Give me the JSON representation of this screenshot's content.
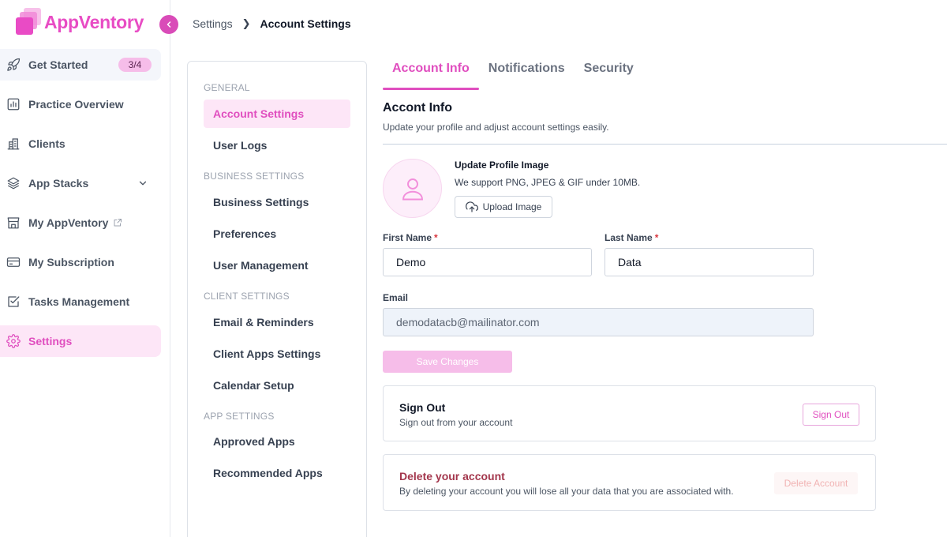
{
  "app": {
    "name": "AppVentory",
    "colors": {
      "accent": "#e04ebf",
      "accent_light": "#fde6f7",
      "danger": "#a3364c"
    }
  },
  "sidebar": {
    "items": [
      {
        "label": "Get Started",
        "icon": "rocket-icon",
        "badge": "3/4"
      },
      {
        "label": "Practice Overview",
        "icon": "chart-icon"
      },
      {
        "label": "Clients",
        "icon": "building-icon"
      },
      {
        "label": "App Stacks",
        "icon": "layers-icon"
      },
      {
        "label": "My AppVentory",
        "icon": "store-icon"
      },
      {
        "label": "My Subscription",
        "icon": "credit-card-icon"
      },
      {
        "label": "Tasks Management",
        "icon": "checkbox-icon"
      },
      {
        "label": "Settings",
        "icon": "gear-icon"
      }
    ]
  },
  "breadcrumb": {
    "parent": "Settings",
    "current": "Account Settings"
  },
  "settings_nav": {
    "sections": [
      {
        "title": "GENERAL",
        "items": [
          "Account Settings",
          "User Logs"
        ]
      },
      {
        "title": "BUSINESS SETTINGS",
        "items": [
          "Business Settings",
          "Preferences",
          "User Management"
        ]
      },
      {
        "title": "CLIENT SETTINGS",
        "items": [
          "Email & Reminders",
          "Client Apps Settings",
          "Calendar Setup"
        ]
      },
      {
        "title": "APP SETTINGS",
        "items": [
          "Approved Apps",
          "Recommended Apps"
        ]
      }
    ]
  },
  "tabs": [
    "Account Info",
    "Notifications",
    "Security"
  ],
  "account_info": {
    "title": "Accont Info",
    "subtitle": "Update your profile and adjust account settings easily."
  },
  "profile_image": {
    "title": "Update Profile Image",
    "subtitle": "We support PNG, JPEG & GIF under 10MB.",
    "upload_label": "Upload Image"
  },
  "form": {
    "first_name": {
      "label": "First Name",
      "value": "Demo"
    },
    "last_name": {
      "label": "Last Name",
      "value": "Data"
    },
    "email": {
      "label": "Email",
      "value": "demodatacb@mailinator.com"
    },
    "required_mark": "*",
    "save_label": "Save Changes"
  },
  "sign_out": {
    "title": "Sign Out",
    "subtitle": "Sign out from your account",
    "button": "Sign Out"
  },
  "delete_account": {
    "title": "Delete your account",
    "subtitle": "By deleting your account you will lose all your data that you are associated with.",
    "button": "Delete Account"
  }
}
